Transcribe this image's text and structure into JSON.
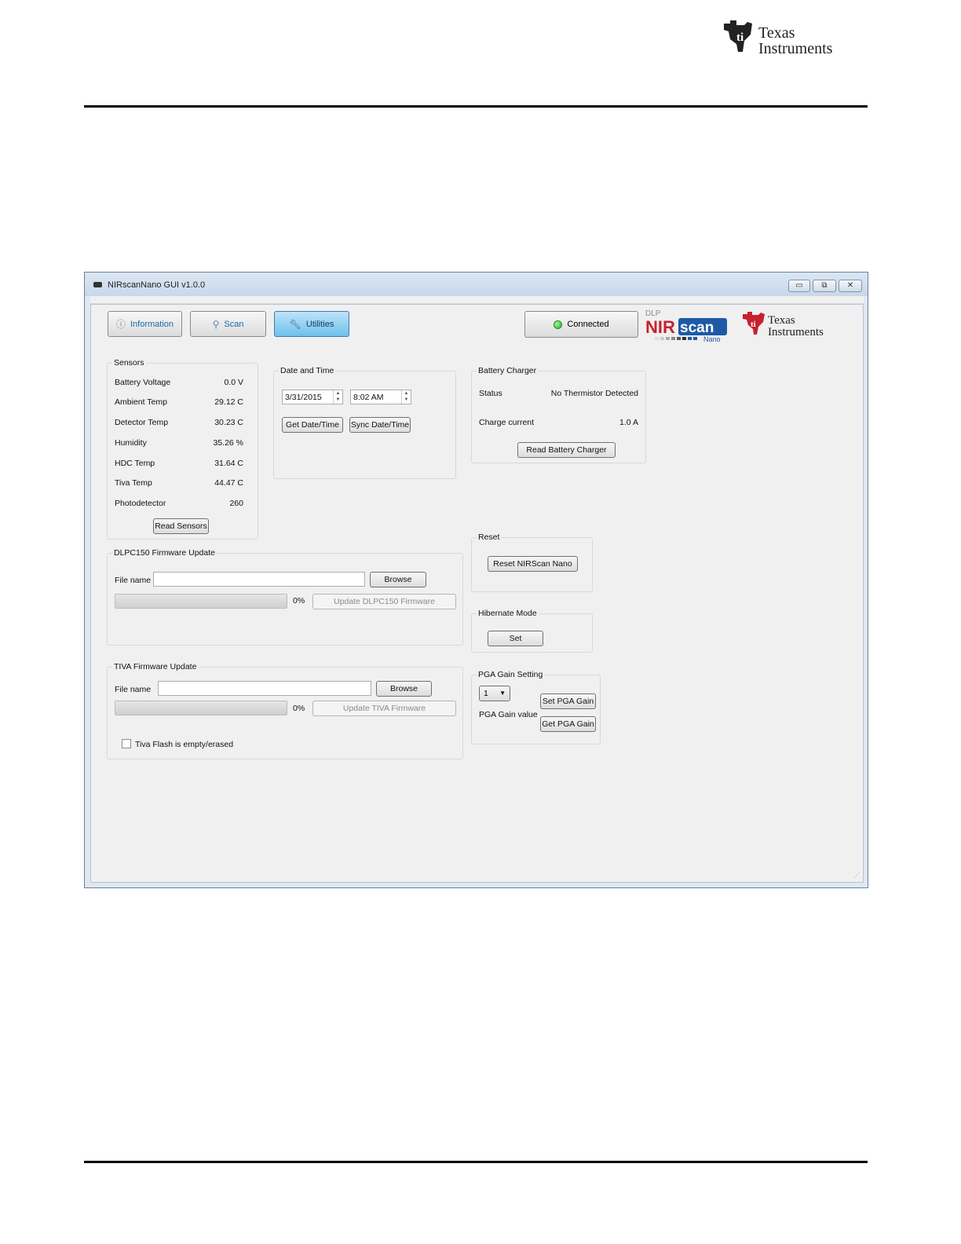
{
  "window": {
    "title": "NIRscanNano GUI v1.0.0",
    "controls": {
      "minimize": "▭",
      "restore": "⧉",
      "close": "✕"
    }
  },
  "tabs": [
    {
      "label": "Information",
      "icon": "info-icon"
    },
    {
      "label": "Scan",
      "icon": "wand-icon"
    },
    {
      "label": "Utilities",
      "icon": "wrench-icon",
      "active": true
    }
  ],
  "status": {
    "label": "Connected",
    "led_color": "#1fb31a"
  },
  "logos": {
    "ti_line1": "Texas",
    "ti_line2": "Instruments",
    "nir_top": "DLP",
    "nir_main1": "NIR",
    "nir_main2": "scan",
    "nir_sub": "Nano"
  },
  "sensors": {
    "title": "Sensors",
    "rows": [
      {
        "label": "Battery Voltage",
        "value": "0.0 V"
      },
      {
        "label": "Ambient Temp",
        "value": "29.12 C"
      },
      {
        "label": "Detector Temp",
        "value": "30.23 C"
      },
      {
        "label": "Humidity",
        "value": "35.26 %"
      },
      {
        "label": "HDC Temp",
        "value": "31.64 C"
      },
      {
        "label": "Tiva Temp",
        "value": "44.47 C"
      },
      {
        "label": "Photodetector",
        "value": "260"
      }
    ],
    "read_button": "Read Sensors"
  },
  "datetime": {
    "title": "Date and Time",
    "date": "3/31/2015",
    "time": "8:02 AM",
    "get_button": "Get Date/Time",
    "sync_button": "Sync Date/Time"
  },
  "battery": {
    "title": "Battery Charger",
    "status_label": "Status",
    "status_value": "No Thermistor Detected",
    "current_label": "Charge current",
    "current_value": "1.0 A",
    "read_button": "Read Battery Charger"
  },
  "dlpc": {
    "title": "DLPC150 Firmware Update",
    "file_label": "File name",
    "file_value": "",
    "browse_button": "Browse",
    "progress_text": "0%",
    "progress": 0,
    "update_button": "Update DLPC150 Firmware"
  },
  "tiva": {
    "title": "TIVA Firmware Update",
    "file_label": "File name",
    "file_value": "",
    "browse_button": "Browse",
    "progress_text": "0%",
    "progress": 0,
    "update_button": "Update TIVA Firmware",
    "checkbox_label": "Tiva Flash is empty/erased",
    "checked": false
  },
  "reset": {
    "title": "Reset",
    "button": "Reset NIRScan Nano"
  },
  "hibernate": {
    "title": "Hibernate Mode",
    "button": "Set"
  },
  "pga": {
    "title": "PGA Gain Setting",
    "selected": "1",
    "value_label": "PGA Gain value",
    "set_button": "Set PGA Gain",
    "get_button": "Get PGA Gain"
  }
}
